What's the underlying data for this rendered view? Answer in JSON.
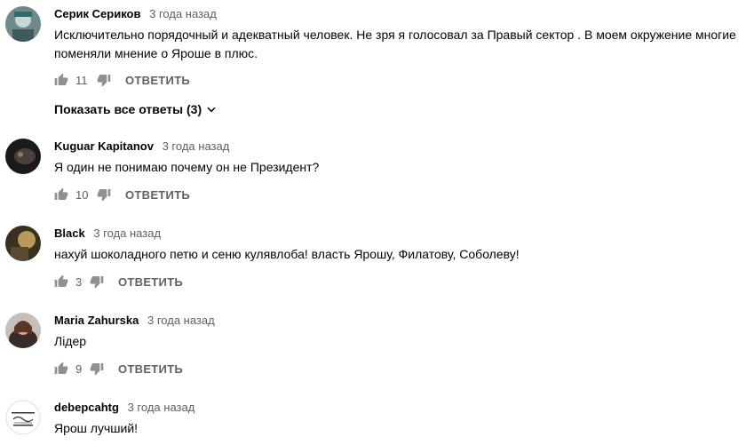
{
  "actions": {
    "reply_label": "ОТВЕТИТЬ"
  },
  "comments": [
    {
      "author": "Серик Сериков",
      "time": "3 года назад",
      "text_lines": [
        "Исключительно порядочный и адекватный человек. Не зря я голосовал за Правый сектор . В моем окружение многие",
        "поменяли мнение о Яроше в плюс."
      ],
      "likes": "11",
      "avatar_icon": "avatar-photo-icon",
      "show_replies_label": "Показать все ответы (3)"
    },
    {
      "author": "Kuguar Kapitanov",
      "time": "3 года назад",
      "text_lines": [
        "Я один не понимаю почему он не Президент?"
      ],
      "likes": "10",
      "avatar_icon": "avatar-photo-icon"
    },
    {
      "author": "Black",
      "time": "3 года назад",
      "text_lines": [
        "нахуй шоколадного петю и сеню кулявлоба! власть Ярошу, Филатову, Соболеву!"
      ],
      "likes": "3",
      "avatar_icon": "avatar-photo-icon"
    },
    {
      "author": "Maria Zahurska",
      "time": "3 года назад",
      "text_lines": [
        "Лідер"
      ],
      "likes": "9",
      "avatar_icon": "avatar-photo-icon"
    },
    {
      "author": "debepcahtg",
      "time": "3 года назад",
      "text_lines": [
        "Ярош лучший!"
      ],
      "avatar_icon": "avatar-logo-icon"
    }
  ]
}
